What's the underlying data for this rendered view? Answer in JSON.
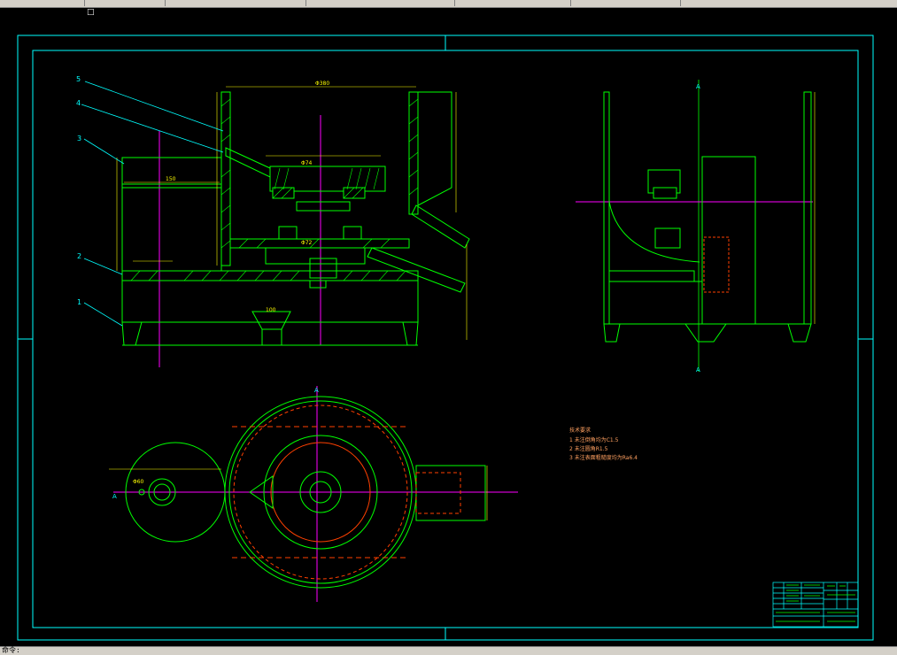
{
  "toolbar": {
    "indicator": "□"
  },
  "status": {
    "command_line": "命令:"
  },
  "drawing": {
    "callouts": [
      "5",
      "4",
      "3",
      "2",
      "1"
    ],
    "section_marks": {
      "a1": "A",
      "a2": "A",
      "a3": "A",
      "a4": "A"
    },
    "tech_req": {
      "title": "技术要求",
      "lines": [
        "1 未注倒角均为C1.5",
        "2 未注圆角R1.5",
        "3 未注表面粗糙度均为Ra6.4"
      ]
    },
    "dims": {
      "top_width": "Φ380",
      "d_inner": "Φ74",
      "d_bot": "Φ72",
      "d_small": "Φ60",
      "r1": "150",
      "r2": "100"
    }
  },
  "colors": {
    "frame": "#00ffff",
    "outline": "#00ff00",
    "dim": "#ffff00",
    "center": "#ff00ff",
    "hidden": "#ff4000",
    "text": "#ffa060"
  }
}
